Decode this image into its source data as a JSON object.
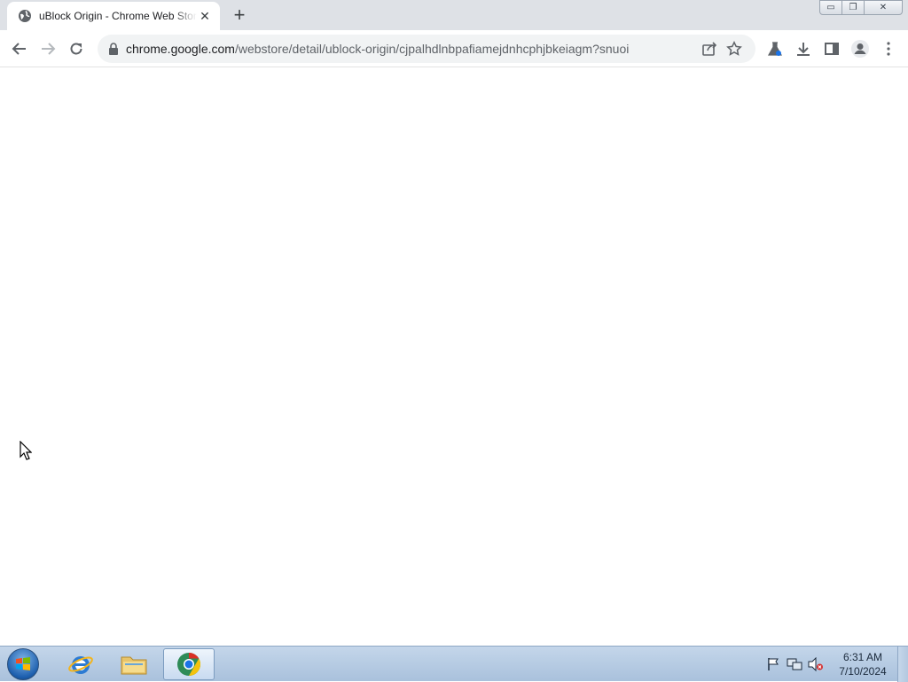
{
  "browser": {
    "tab": {
      "title": "uBlock Origin - Chrome Web Store",
      "close_glyph": "✕"
    },
    "new_tab_glyph": "+",
    "window_controls": {
      "minimize_glyph": "▭",
      "maximize_glyph": "❐",
      "close_glyph": "✕"
    },
    "address": {
      "host": "chrome.google.com",
      "path": "/webstore/detail/ublock-origin/cjpalhdlnbpafiamejdnhcphjbkeiagm?snuoi"
    },
    "icons": [
      "back-icon",
      "forward-icon",
      "reload-icon",
      "lock-icon",
      "share-icon",
      "bookmark-star-icon",
      "extensions-lab-icon",
      "download-icon",
      "side-panel-icon",
      "profile-icon",
      "menu-icon"
    ]
  },
  "taskbar": {
    "items": [
      "start-orb",
      "internet-explorer",
      "windows-explorer",
      "chrome"
    ],
    "clock": {
      "time": "6:31 AM",
      "date": "7/10/2024"
    },
    "tray_icons": [
      "action-center-flag-icon",
      "network-icon",
      "volume-muted-icon"
    ]
  },
  "colors": {
    "tabstrip": "#dee1e6",
    "omnibox": "#f1f3f4",
    "taskbar": "#b6cbe3"
  }
}
